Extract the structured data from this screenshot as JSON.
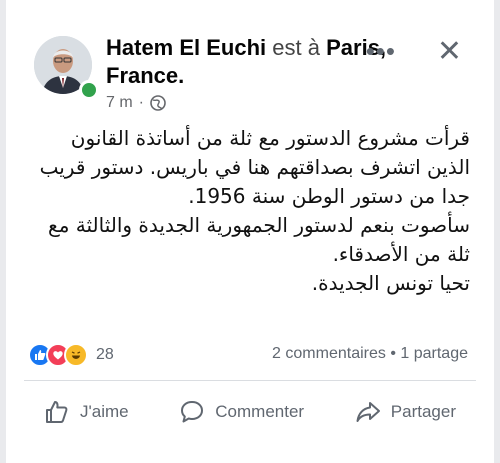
{
  "post": {
    "author": "Hatem El Euchi",
    "checkin_text": "est à",
    "location": "Paris, France.",
    "time": "7 m",
    "separator": "·",
    "paragraphs": [
      "قرأت مشروع الدستور مع ثلة من أساتذة القانون الذين اتشرف بصداقتهم هنا في باريس. دستور قريب جدا من دستور الوطن سنة 1956.",
      "سأصوت بنعم لدستور الجمهورية الجديدة والثالثة مع ثلة من الأصدقاء.",
      "تحيا تونس الجديدة."
    ]
  },
  "engagement": {
    "reaction_count": "28",
    "comments_label": "2 commentaires",
    "shares_separator": "•",
    "shares_label": "1 partage"
  },
  "actions": {
    "like": "J'aime",
    "comment": "Commenter",
    "share": "Partager"
  },
  "header_controls": {
    "more": "•••",
    "close": "✕"
  },
  "colors": {
    "like_blue": "#1877f2",
    "love_red": "#f33e58",
    "haha_yellow": "#f7b928",
    "online_green": "#31a24c"
  }
}
